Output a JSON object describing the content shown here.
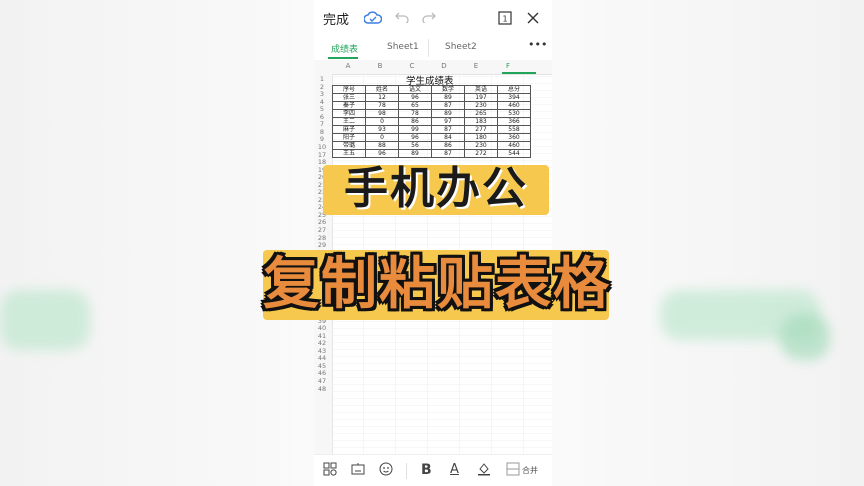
{
  "app": {
    "done_label": "完成",
    "icons": [
      "cloud-sync-icon",
      "undo-icon",
      "redo-icon",
      "page-count-icon",
      "close-icon"
    ],
    "page_count": "1"
  },
  "tabs": [
    {
      "label": "成绩表"
    },
    {
      "label": "Sheet1"
    },
    {
      "label": "Sheet2"
    }
  ],
  "more_label": "•••",
  "columns": [
    "A",
    "B",
    "C",
    "D",
    "E",
    "F"
  ],
  "rows_visible": [
    1,
    2,
    3,
    4,
    5,
    6,
    7,
    8,
    9,
    10,
    17,
    18,
    19,
    20,
    21,
    22,
    23,
    24,
    25,
    26,
    27,
    28,
    29,
    30,
    31,
    32,
    33,
    34,
    35,
    36,
    37,
    38,
    39,
    40,
    41,
    42,
    43,
    44,
    45,
    46,
    47,
    48
  ],
  "sheet_title": "学生成绩表",
  "table": {
    "headers": [
      "序号",
      "姓名",
      "语文",
      "数学",
      "英语",
      "总分"
    ],
    "rows": [
      [
        "张三",
        "12",
        "96",
        "89",
        "197",
        "394"
      ],
      [
        "秦子",
        "78",
        "65",
        "87",
        "230",
        "460"
      ],
      [
        "李四",
        "98",
        "78",
        "89",
        "265",
        "530"
      ],
      [
        "王二",
        "0",
        "86",
        "97",
        "183",
        "366"
      ],
      [
        "麻子",
        "93",
        "99",
        "87",
        "277",
        "558"
      ],
      [
        "阳子",
        "0",
        "96",
        "84",
        "180",
        "360"
      ],
      [
        "带璐",
        "88",
        "56",
        "86",
        "230",
        "460"
      ],
      [
        "王五",
        "96",
        "89",
        "87",
        "272",
        "544"
      ]
    ]
  },
  "overlay": {
    "line1": "手机办公",
    "line2": "复制粘贴表格"
  },
  "bottom_toolbar": {
    "bold": "B",
    "font_color": "A",
    "merge_label": "合并"
  },
  "colors": {
    "accent": "#22a45a",
    "highlight": "#f6c94e",
    "title2": "#e98b3c"
  }
}
